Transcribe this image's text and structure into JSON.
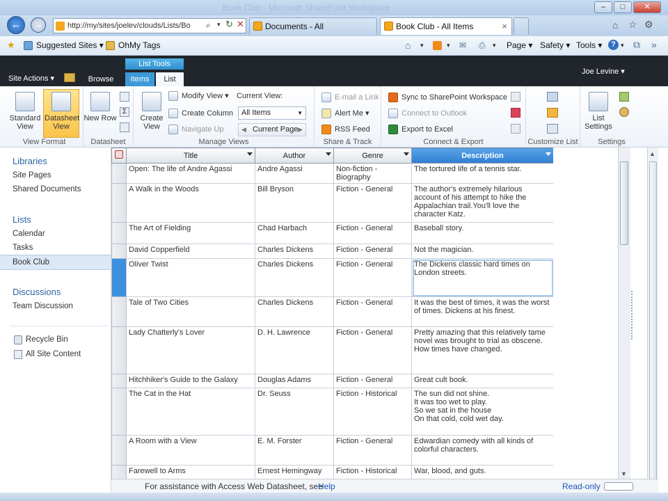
{
  "window": {
    "title": "Book Club - Microsoft SharePoint Workspace"
  },
  "browser": {
    "url": "http://my/sites/joelev/clouds/Lists/Bo",
    "tabs": [
      {
        "label": "Documents - All"
      },
      {
        "label": "Book Club - All Items"
      }
    ],
    "favorites": {
      "suggested": "Suggested Sites ▾",
      "ohmy": "OhMy Tags"
    },
    "command_bar": {
      "page": "Page ▾",
      "safety": "Safety ▾",
      "tools": "Tools ▾"
    }
  },
  "sharepoint": {
    "site_actions": "Site Actions ▾",
    "tabs": {
      "browse": "Browse",
      "items": "Items",
      "list": "List"
    },
    "list_tools": "List Tools",
    "user": "Joe Levine ▾"
  },
  "ribbon": {
    "view_format": {
      "label": "View Format",
      "standard": "Standard View",
      "datasheet": "Datasheet View"
    },
    "datasheet": {
      "label": "Datasheet",
      "new_row": "New Row"
    },
    "manage_views": {
      "label": "Manage Views",
      "create_view": "Create View",
      "modify_view": "Modify View ▾",
      "create_column": "Create Column",
      "navigate_up": "Navigate Up",
      "current_view_label": "Current View:",
      "current_view_value": "All Items",
      "current_page": "Current Page"
    },
    "share_track": {
      "label": "Share & Track",
      "email": "E-mail a Link",
      "alert": "Alert Me ▾",
      "rss": "RSS Feed"
    },
    "connect_export": {
      "label": "Connect & Export",
      "sync": "Sync to SharePoint Workspace",
      "outlook": "Connect to Outlook",
      "excel": "Export to Excel"
    },
    "customize_list": {
      "label": "Customize List"
    },
    "settings": {
      "label": "Settings",
      "list_settings": "List Settings"
    }
  },
  "leftnav": {
    "libraries_head": "Libraries",
    "libraries": [
      "Site Pages",
      "Shared Documents"
    ],
    "lists_head": "Lists",
    "lists": [
      "Calendar",
      "Tasks",
      "Book Club"
    ],
    "discussions_head": "Discussions",
    "discussions": [
      "Team Discussion"
    ],
    "recycle_bin": "Recycle Bin",
    "all_site_content": "All Site Content"
  },
  "grid": {
    "columns": [
      "Title",
      "Author",
      "Genre",
      "Description"
    ],
    "rows": [
      {
        "title": "Open: The life of Andre Agassi",
        "author": "Andre Agassi",
        "genre": "Non-fiction - Biography",
        "description": "The tortured life of a tennis star."
      },
      {
        "title": "A Walk in the Woods",
        "author": "Bill Bryson",
        "genre": "Fiction - General",
        "description": "The author's extremely hilarious account of his attempt to hike the Appalachian trail.You'll love the character Katz."
      },
      {
        "title": "The Art of Fielding",
        "author": "Chad Harbach",
        "genre": "Fiction - General",
        "description": "Baseball story."
      },
      {
        "title": "David Copperfield",
        "author": "Charles Dickens",
        "genre": "Fiction - General",
        "description": "Not the magician."
      },
      {
        "title": "Oliver Twist",
        "author": "Charles Dickens",
        "genre": "Fiction - General",
        "description": "The Dickens classic hard times on London streets."
      },
      {
        "title": "Tale of Two Cities",
        "author": "Charles Dickens",
        "genre": "Fiction - General",
        "description": "It was the best of times, it was the worst of times. Dickens at his finest."
      },
      {
        "title": "Lady Chatterly's Lover",
        "author": "D. H. Lawrence",
        "genre": "Fiction - General",
        "description": "Pretty amazing that this relatively tame novel was brought to trial as obscene. How times have changed."
      },
      {
        "title": "Hitchhiker's Guide to the Galaxy",
        "author": "Douglas Adams",
        "genre": "Fiction - General",
        "description": "Great cult book."
      },
      {
        "title": "The Cat in the Hat",
        "author": "Dr. Seuss",
        "genre": "Fiction - Historical",
        "description": "The sun did not shine.\nIt was too wet to play.\nSo we sat in the house\nOn that cold, cold wet day."
      },
      {
        "title": "A Room with a View",
        "author": "E. M. Forster",
        "genre": "Fiction - General",
        "description": "Edwardian comedy with all kinds of colorful characters."
      },
      {
        "title": "Farewell to Arms",
        "author": "Ernest Hemingway",
        "genre": "Fiction - Historical",
        "description": "War, blood, and guts."
      }
    ]
  },
  "status": {
    "assist": "For assistance with Access Web Datasheet, see ",
    "help": "Help",
    "readonly": "Read-only"
  }
}
